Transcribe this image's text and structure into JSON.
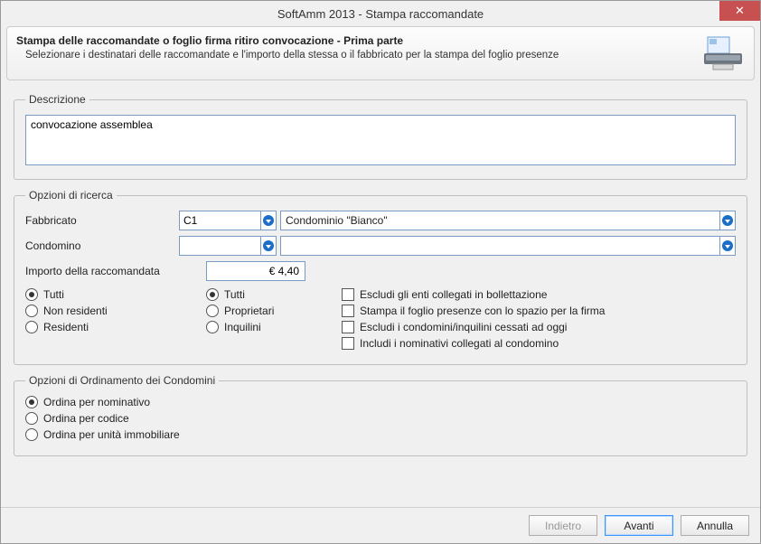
{
  "window": {
    "title": "SoftAmm 2013 - Stampa raccomandate"
  },
  "header": {
    "title": "Stampa delle raccomandate o foglio firma ritiro convocazione - Prima parte",
    "subtitle": "Selezionare i destinatari delle raccomandate e l'importo della stessa o il fabbricato per la stampa del foglio presenze"
  },
  "descrizione": {
    "legend": "Descrizione",
    "value": "convocazione assemblea"
  },
  "ricerca": {
    "legend": "Opzioni di ricerca",
    "fabbricato_label": "Fabbricato",
    "fabbricato_code": "C1",
    "fabbricato_name": "Condominio \"Bianco\"",
    "condomino_label": "Condomino",
    "condomino_code": "",
    "condomino_name": "",
    "importo_label": "Importo della raccomandata",
    "importo_value": "€ 4,40",
    "col1": {
      "tutti": "Tutti",
      "non_residenti": "Non residenti",
      "residenti": "Residenti"
    },
    "col2": {
      "tutti": "Tutti",
      "proprietari": "Proprietari",
      "inquilini": "Inquilini"
    },
    "col3": {
      "escludi_enti": "Escludi gli enti collegati in bollettazione",
      "stampa_foglio": "Stampa il foglio presenze con lo spazio per la firma",
      "escludi_cessati": "Escludi i condomini/inquilini cessati ad oggi",
      "includi_nominativi": "Includi i nominativi collegati al condomino"
    }
  },
  "ordinamento": {
    "legend": "Opzioni di Ordinamento dei Condomini",
    "nominativo": "Ordina per nominativo",
    "codice": "Ordina per codice",
    "unita": "Ordina per unità immobiliare"
  },
  "footer": {
    "indietro": "Indietro",
    "avanti": "Avanti",
    "annulla": "Annulla"
  }
}
